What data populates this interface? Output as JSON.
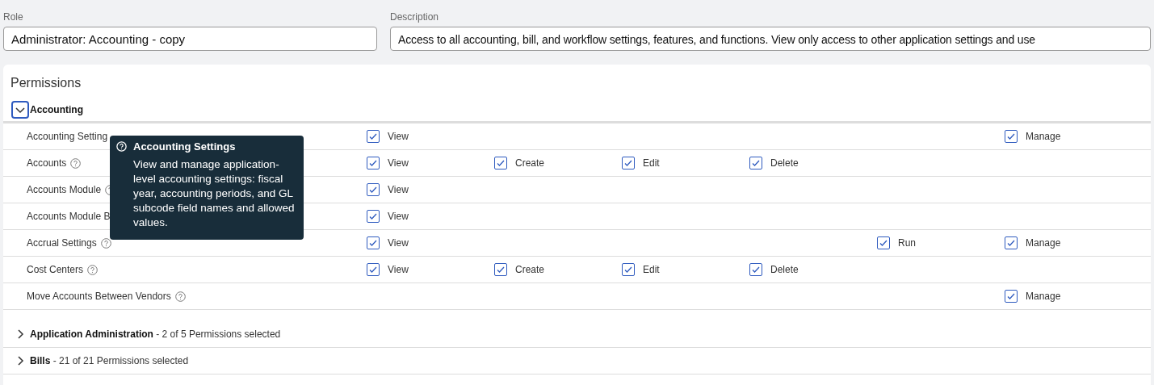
{
  "role": {
    "label": "Role",
    "value": "Administrator: Accounting - copy"
  },
  "description": {
    "label": "Description",
    "value": "Access to all accounting, bill, and workflow settings, features, and functions. View only access to other application settings and use"
  },
  "permissions": {
    "title": "Permissions",
    "sections": [
      {
        "name": "Accounting",
        "expanded": true,
        "rows": [
          {
            "label": "Accounting Setting",
            "help": false,
            "options": [
              {
                "kind": "view",
                "label": "View",
                "checked": true
              },
              {
                "kind": "manage",
                "label": "Manage",
                "checked": true
              }
            ]
          },
          {
            "label": "Accounts",
            "help": true,
            "options": [
              {
                "kind": "view",
                "label": "View",
                "checked": true
              },
              {
                "kind": "create",
                "label": "Create",
                "checked": true
              },
              {
                "kind": "edit",
                "label": "Edit",
                "checked": true
              },
              {
                "kind": "delete",
                "label": "Delete",
                "checked": true
              }
            ]
          },
          {
            "label": "Accounts Module",
            "help": true,
            "options": [
              {
                "kind": "view",
                "label": "View",
                "checked": true
              }
            ]
          },
          {
            "label": "Accounts Module B",
            "help": false,
            "options": [
              {
                "kind": "view",
                "label": "View",
                "checked": true
              }
            ]
          },
          {
            "label": "Accrual Settings",
            "help": true,
            "options": [
              {
                "kind": "view",
                "label": "View",
                "checked": true
              },
              {
                "kind": "run",
                "label": "Run",
                "checked": true
              },
              {
                "kind": "manage",
                "label": "Manage",
                "checked": true
              }
            ]
          },
          {
            "label": "Cost Centers",
            "help": true,
            "options": [
              {
                "kind": "view",
                "label": "View",
                "checked": true
              },
              {
                "kind": "create",
                "label": "Create",
                "checked": true
              },
              {
                "kind": "edit",
                "label": "Edit",
                "checked": true
              },
              {
                "kind": "delete",
                "label": "Delete",
                "checked": true
              }
            ]
          },
          {
            "label": "Move Accounts Between Vendors",
            "help": true,
            "options": [
              {
                "kind": "manage",
                "label": "Manage",
                "checked": true
              }
            ]
          }
        ]
      },
      {
        "name": "Application Administration",
        "summary": " - 2 of 5 Permissions selected",
        "expanded": false
      },
      {
        "name": "Bills",
        "summary": " - 21 of 21 Permissions selected",
        "expanded": false
      }
    ]
  },
  "tooltip": {
    "title": "Accounting Settings",
    "text": "View and manage application-level accounting settings: fiscal year, accounting periods, and GL subcode field names and allowed values."
  }
}
